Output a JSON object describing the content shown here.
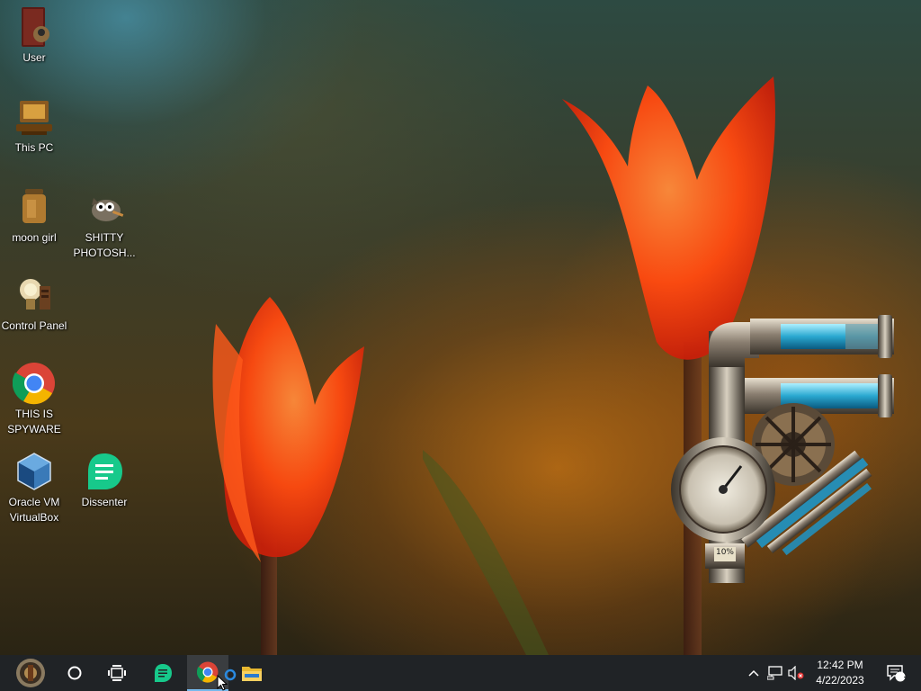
{
  "desktop": {
    "icons": [
      {
        "label": "User",
        "icon": "user-folder-icon"
      },
      {
        "label": "This PC",
        "icon": "computer-icon"
      },
      {
        "label": "moon girl",
        "icon": "jar-icon"
      },
      {
        "label": "SHITTY PHOTOSH...",
        "icon": "gimp-icon"
      },
      {
        "label": "Control Panel",
        "icon": "lightbulb-icon"
      },
      {
        "label": "THIS IS SPYWARE",
        "icon": "chrome-icon"
      },
      {
        "label": "Oracle VM VirtualBox",
        "icon": "virtualbox-icon"
      },
      {
        "label": "Dissenter",
        "icon": "dissenter-icon"
      }
    ],
    "widget": {
      "name": "steampunk-meter-widget",
      "percent_label": "10%",
      "level": 0.1
    }
  },
  "taskbar": {
    "start": "start-button",
    "search": "search-circle-icon",
    "task_view": "task-view-icon",
    "apps": [
      "dissenter-icon",
      "chrome-icon",
      "file-explorer-icon"
    ],
    "tray": {
      "time": "12:42 PM",
      "date": "4/22/2023",
      "notification_count": "1"
    },
    "colors": {
      "taskbar_bg": "#202326",
      "chrome_red": "#db4437",
      "chrome_green": "#0f9d58",
      "chrome_yellow": "#f4b400",
      "chrome_blue": "#4285f4",
      "dissenter_green": "#17c98b"
    }
  }
}
